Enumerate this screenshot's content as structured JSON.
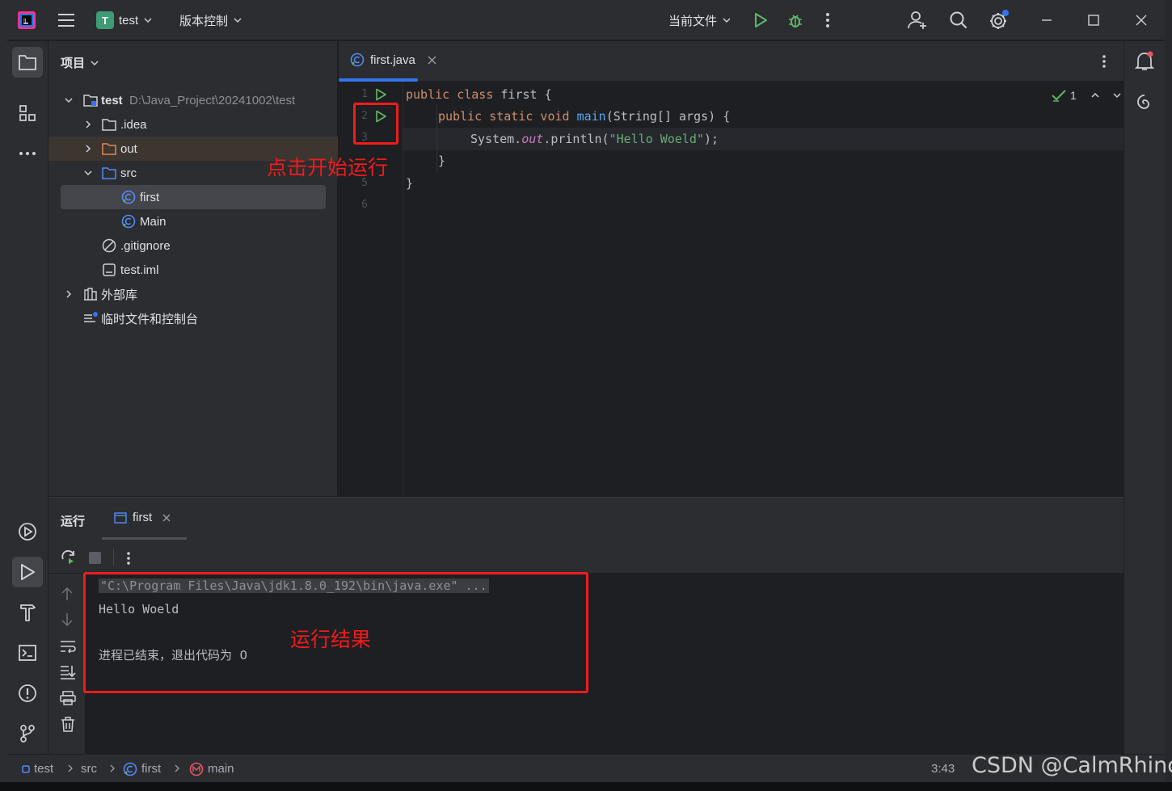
{
  "titlebar": {
    "project_letter": "T",
    "project_name": "test",
    "vcs_label": "版本控制",
    "run_config": "当前文件"
  },
  "project_panel": {
    "title": "项目",
    "tree": [
      {
        "label": "test",
        "path": "D:\\Java_Project\\20241002\\test"
      },
      {
        "label": ".idea"
      },
      {
        "label": "out"
      },
      {
        "label": "src"
      },
      {
        "label": "first"
      },
      {
        "label": "Main"
      },
      {
        "label": ".gitignore"
      },
      {
        "label": "test.iml"
      },
      {
        "label": "外部库"
      },
      {
        "label": "临时文件和控制台"
      }
    ]
  },
  "editor": {
    "tab_label": "first.java",
    "inspection_count": "1",
    "line_numbers": [
      "1",
      "2",
      "3",
      "5",
      "6"
    ],
    "code": {
      "l1_kw": "public class ",
      "l1_rest": "first {",
      "l2_kw": "public static void ",
      "l2_fn": "main",
      "l2_rest": "(String[] args) {",
      "l3_a": "System.",
      "l3_out": "out",
      "l3_b": ".println(",
      "l3_str": "\"Hello Woeld\"",
      "l3_c": ");",
      "l4": "}",
      "l5": "}"
    }
  },
  "run_panel": {
    "title": "运行",
    "tab_label": "first",
    "console": [
      "\"C:\\Program Files\\Java\\jdk1.8.0_192\\bin\\java.exe\" ...",
      "Hello Woeld",
      "进程已结束，退出代码为  0"
    ]
  },
  "status_bar": {
    "crumbs": [
      "test",
      "src",
      "first",
      "main"
    ],
    "position": "3:43"
  },
  "annotations": {
    "run_hint": "点击开始运行",
    "result_hint": "运行结果"
  },
  "watermark": "CSDN @CalmRhino",
  "colors": {
    "accent": "#3574f0",
    "annotation_red": "#f21b1b",
    "run_green": "#5fb865"
  }
}
